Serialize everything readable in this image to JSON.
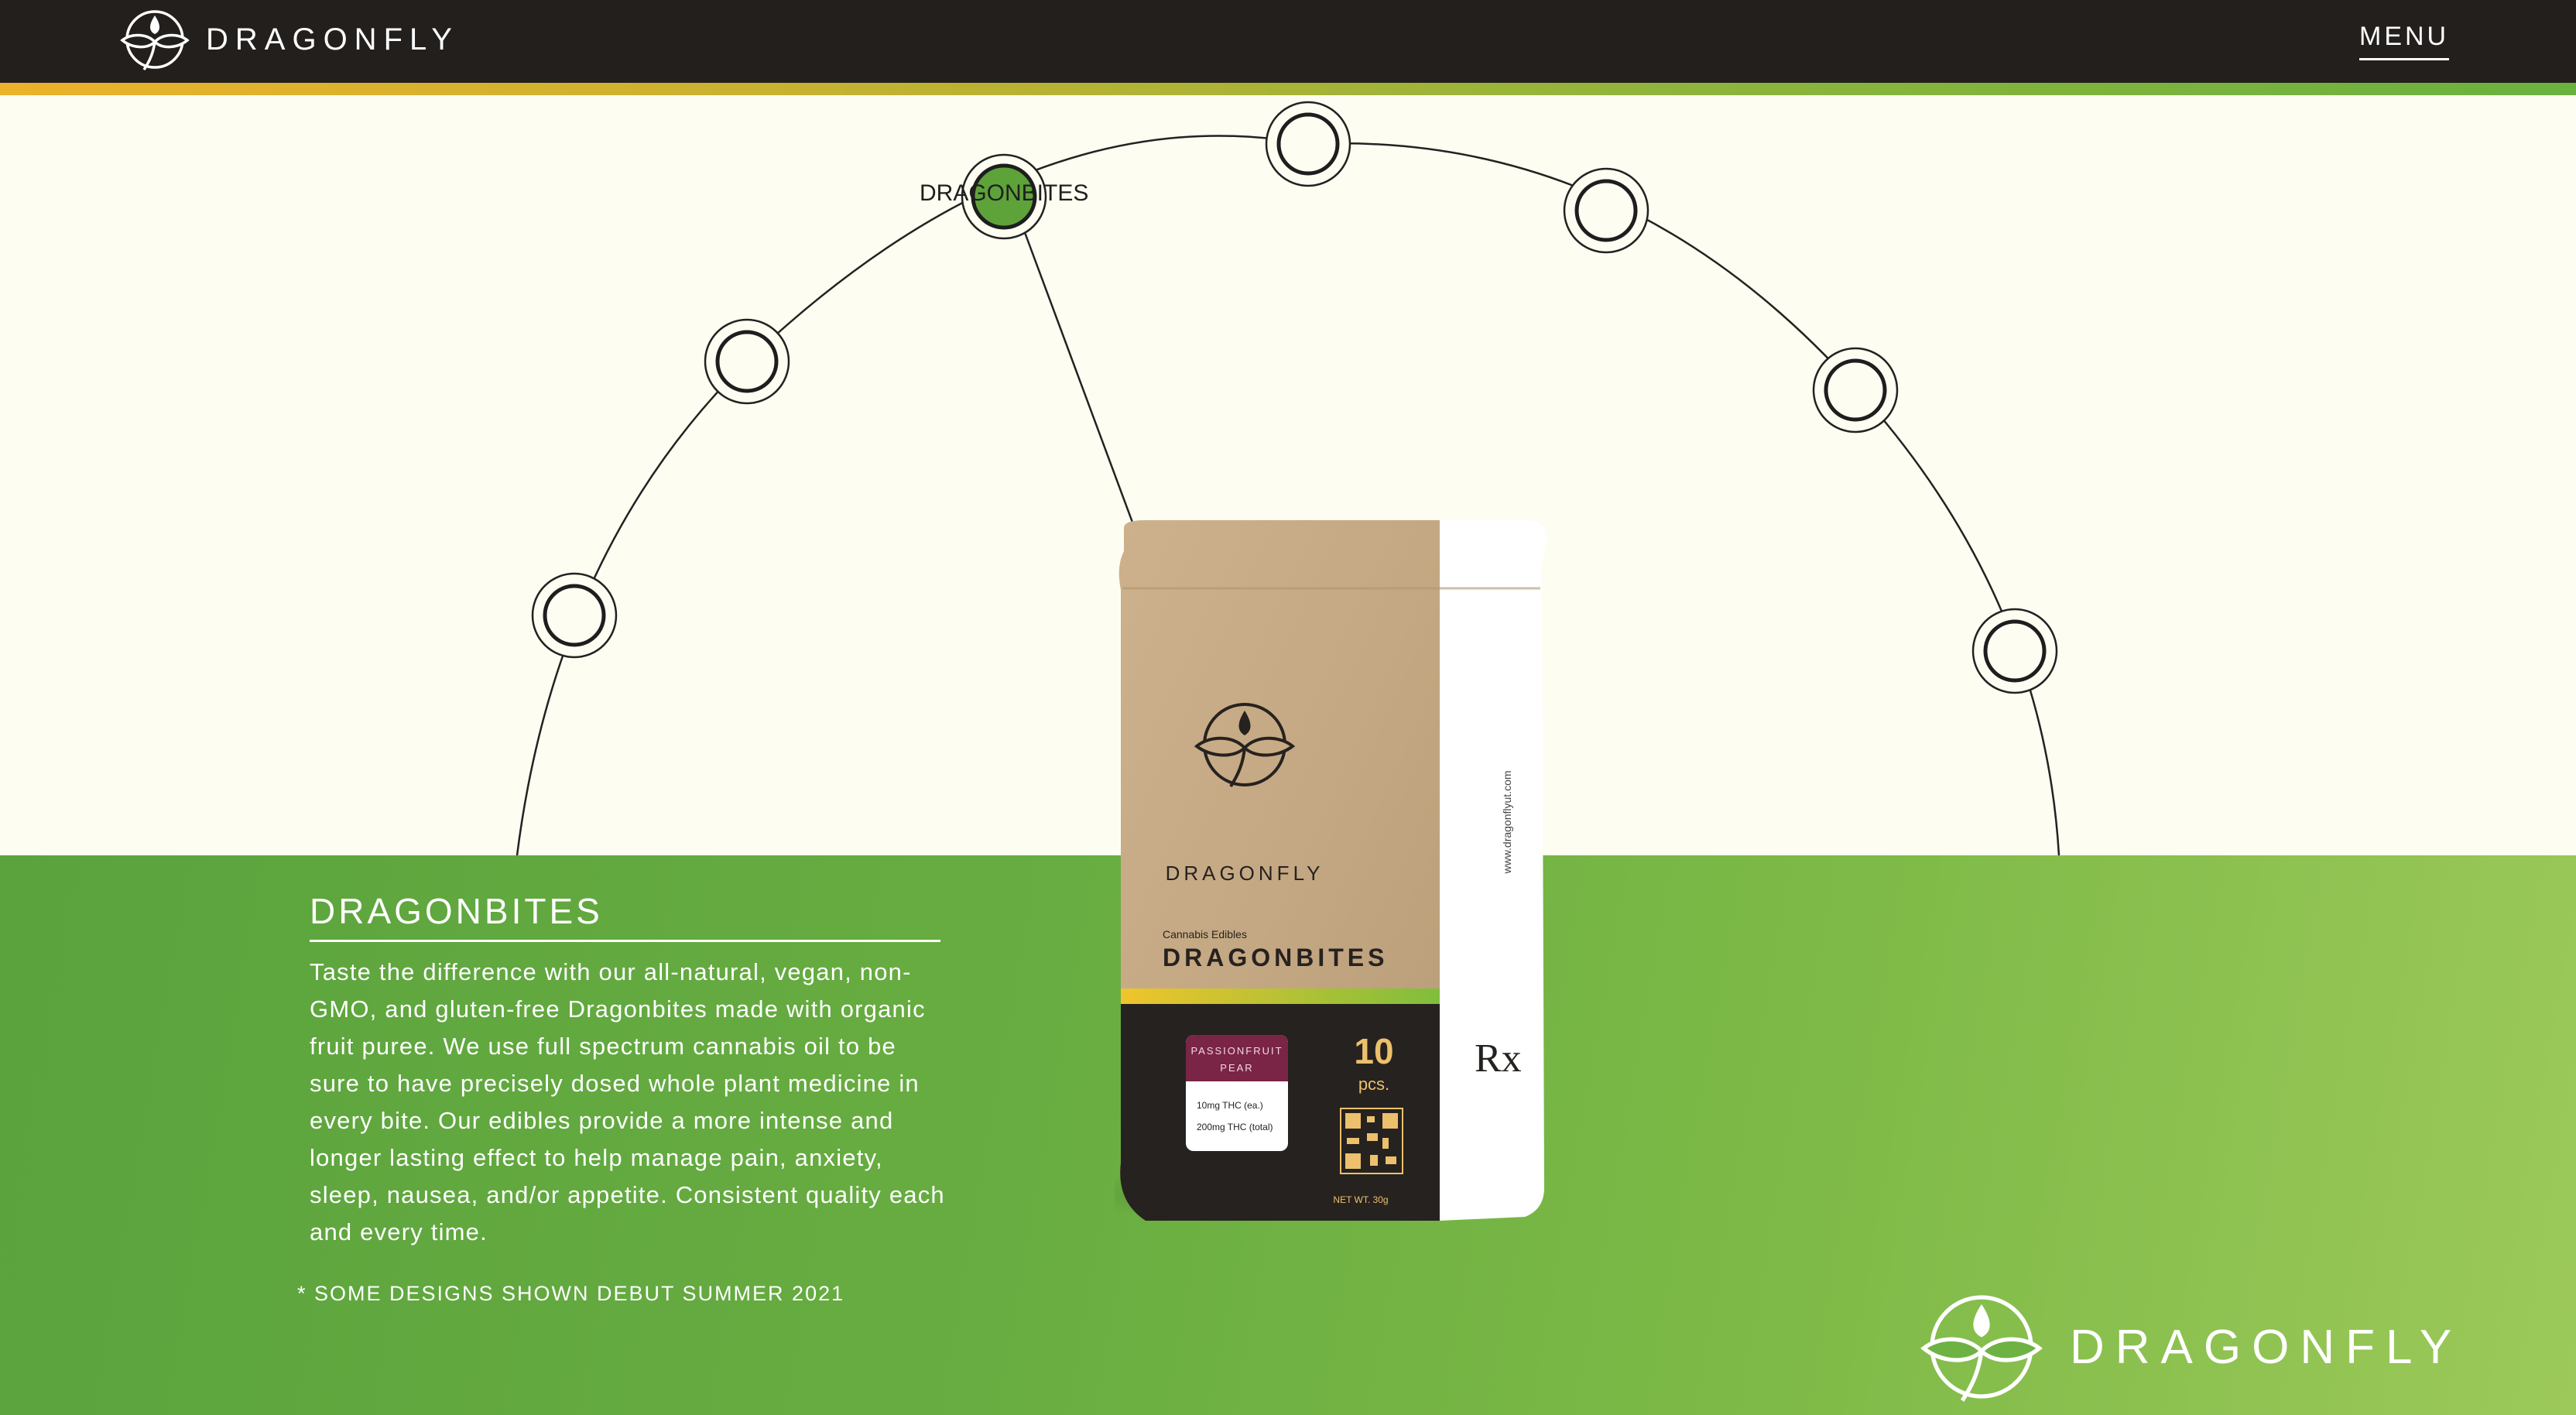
{
  "header": {
    "brand": "DRAGONFLY",
    "menu_label": "MENU",
    "logo_icon": "dragonfly-leaf-icon"
  },
  "carousel": {
    "active_label": "DRAGONBITES",
    "node_count": 8,
    "active_index": 2
  },
  "product": {
    "brand": "DRAGONFLY",
    "category": "Cannabis Edibles",
    "name": "DRAGONBITES",
    "flavor_line1": "PASSIONFRUIT",
    "flavor_line2": "PEAR",
    "dose_each": "10mg THC (ea.)",
    "dose_total": "200mg THC (total)",
    "count": "10",
    "count_unit": "pcs.",
    "rx": "Rx",
    "net_wt": "NET WT. 30g",
    "website": "www.dragonflyut.com"
  },
  "section": {
    "title": "DRAGONBITES",
    "description": "Taste the difference with our all-natural, vegan, non-GMO, and gluten-free Dragonbites made with organic fruit puree. We use full spectrum cannabis oil to be sure to have precisely dosed whole plant medicine in every bite. Our edibles provide a more intense and longer lasting effect to help manage pain, anxiety, sleep, nausea, and/or appetite. Consistent quality each and every time.",
    "footnote": "* SOME DESIGNS SHOWN DEBUT SUMMER 2021"
  },
  "footer": {
    "brand": "DRAGONFLY"
  },
  "colors": {
    "topbar": "#231f1d",
    "cream": "#fefdf1",
    "green": "#6aae42",
    "accent_yellow": "#ecb22b",
    "active_node": "#5ea33a"
  }
}
